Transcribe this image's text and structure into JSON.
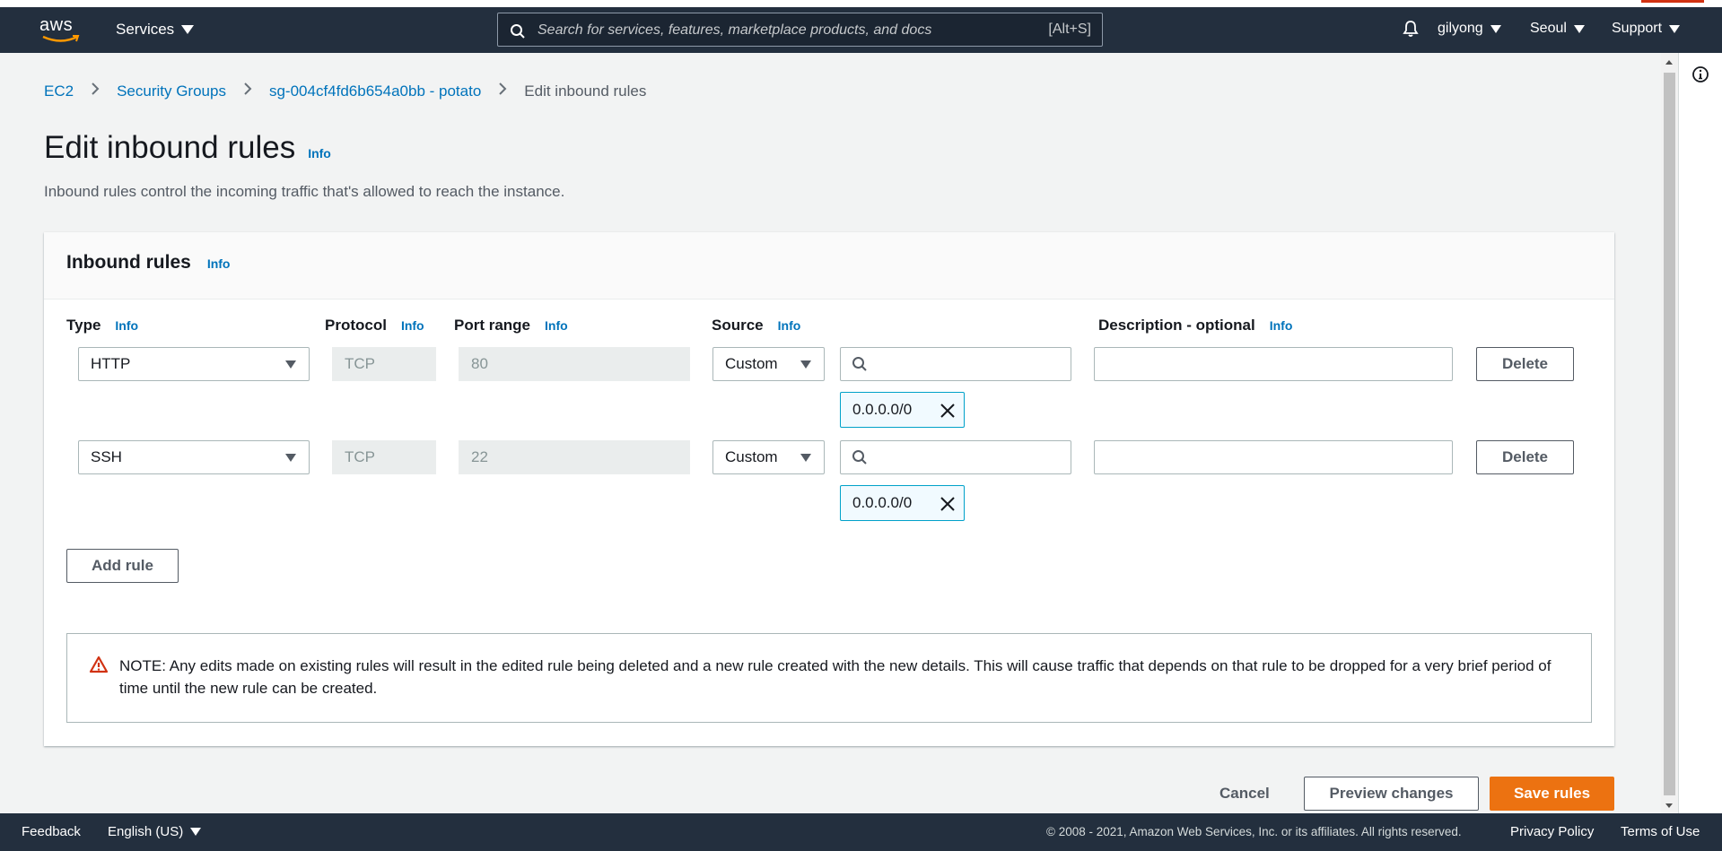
{
  "nav": {
    "logo_text": "aws",
    "services_label": "Services",
    "search_placeholder": "Search for services, features, marketplace products, and docs",
    "search_shortcut": "[Alt+S]",
    "user_label": "gilyong",
    "region_label": "Seoul",
    "support_label": "Support"
  },
  "breadcrumb": {
    "items": [
      "EC2",
      "Security Groups",
      "sg-004cf4fd6b654a0bb - potato"
    ],
    "current": "Edit inbound rules"
  },
  "page": {
    "title": "Edit inbound rules",
    "info_label": "Info",
    "description": "Inbound rules control the incoming traffic that's allowed to reach the instance."
  },
  "panel": {
    "title": "Inbound rules",
    "info_label": "Info",
    "columns": {
      "type": "Type",
      "protocol": "Protocol",
      "port_range": "Port range",
      "source": "Source",
      "description": "Description - optional"
    },
    "rules": [
      {
        "type": "HTTP",
        "protocol": "TCP",
        "port": "80",
        "source": "Custom",
        "cidr": "0.0.0.0/0",
        "description": "",
        "delete_label": "Delete"
      },
      {
        "type": "SSH",
        "protocol": "TCP",
        "port": "22",
        "source": "Custom",
        "cidr": "0.0.0.0/0",
        "description": "",
        "delete_label": "Delete"
      }
    ],
    "add_rule_label": "Add rule",
    "note_text": "NOTE: Any edits made on existing rules will result in the edited rule being deleted and a new rule created with the new details. This will cause traffic that depends on that rule to be dropped for a very brief period of time until the new rule can be created."
  },
  "actions": {
    "cancel": "Cancel",
    "preview": "Preview changes",
    "save": "Save rules"
  },
  "footer": {
    "feedback": "Feedback",
    "language": "English (US)",
    "copyright": "© 2008 - 2021, Amazon Web Services, Inc. or its affiliates. All rights reserved.",
    "privacy": "Privacy Policy",
    "terms": "Terms of Use"
  },
  "colors": {
    "nav_bg": "#232f3e",
    "link": "#0073bb",
    "primary": "#ec7211",
    "token_border": "#00a1c9",
    "warning": "#d13212"
  },
  "icons": [
    "search-icon",
    "bell-icon",
    "caret-down-icon",
    "close-icon",
    "warning-icon",
    "info-circle-icon"
  ]
}
